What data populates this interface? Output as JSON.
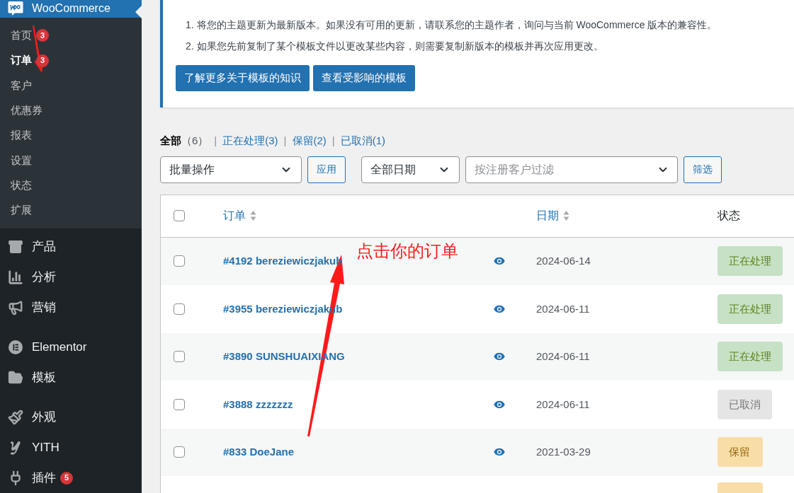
{
  "sidebar": {
    "header": {
      "label": "WooCommerce",
      "selected": true
    },
    "submenu": [
      {
        "label": "首页",
        "badge": "3",
        "selected": false
      },
      {
        "label": "订单",
        "badge": "3",
        "selected": true
      },
      {
        "label": "客户",
        "selected": false
      },
      {
        "label": "优惠券",
        "selected": false
      },
      {
        "label": "报表",
        "selected": false
      },
      {
        "label": "设置",
        "selected": false
      },
      {
        "label": "状态",
        "selected": false
      },
      {
        "label": "扩展",
        "selected": false
      }
    ],
    "menu_groups": [
      [
        {
          "label": "产品"
        },
        {
          "label": "分析"
        },
        {
          "label": "营销"
        }
      ],
      [
        {
          "label": "Elementor"
        },
        {
          "label": "模板"
        }
      ],
      [
        {
          "label": "外观"
        },
        {
          "label": "YITH"
        },
        {
          "label": "插件",
          "badge": "5"
        }
      ]
    ]
  },
  "notice": {
    "lines": [
      "1. 将您的主题更新为最新版本。如果没有可用的更新，请联系您的主题作者，询问与当前 WooCommerce 版本的兼容性。",
      "2. 如果您先前复制了某个模板文件以更改某些内容，则需要复制新版本的模板并再次应用更改。"
    ],
    "buttons": [
      "了解更多关于模板的知识",
      "查看受影响的模板"
    ]
  },
  "status_filters": [
    {
      "label": "全部",
      "count": "（6）",
      "selected": true
    },
    {
      "separator": "|",
      "label": "正在处理",
      "count": "(3)",
      "selected": false
    },
    {
      "separator": "|",
      "label": "保留",
      "count": "(2)",
      "selected": false
    },
    {
      "separator": "|",
      "label": "已取消",
      "count": "(1)",
      "selected": false
    }
  ],
  "filters": {
    "bulk_action": "批量操作",
    "apply_button": "应用",
    "date_select": "全部日期",
    "customer_search": {
      "placeholder": "按注册客户过滤"
    },
    "filter_button": "筛选"
  },
  "table": {
    "select_all_checked": false,
    "columns": [
      "订单",
      "日期",
      "状态"
    ],
    "rows": [
      {
        "order": "#4192 bereziewiczjakub",
        "date": "2024-06-14",
        "status": "正在处理",
        "kind": "processing",
        "checked": false
      },
      {
        "order": "#3955 bereziewiczjakub",
        "date": "2024-06-11",
        "status": "正在处理",
        "kind": "processing",
        "checked": false
      },
      {
        "order": "#3890 SUNSHUAIXIANG",
        "date": "2024-06-11",
        "status": "正在处理",
        "kind": "processing",
        "checked": false
      },
      {
        "order": "#3888 zzzzzzz",
        "date": "2024-06-11",
        "status": "已取消",
        "kind": "cancelled",
        "checked": false
      },
      {
        "order": "#833 DoeJane",
        "date": "2021-03-29",
        "status": "保留",
        "kind": "on-hold",
        "checked": false
      },
      {
        "kind": "on-hold"
      }
    ]
  },
  "annotation": {
    "text": "点击你的订单"
  }
}
